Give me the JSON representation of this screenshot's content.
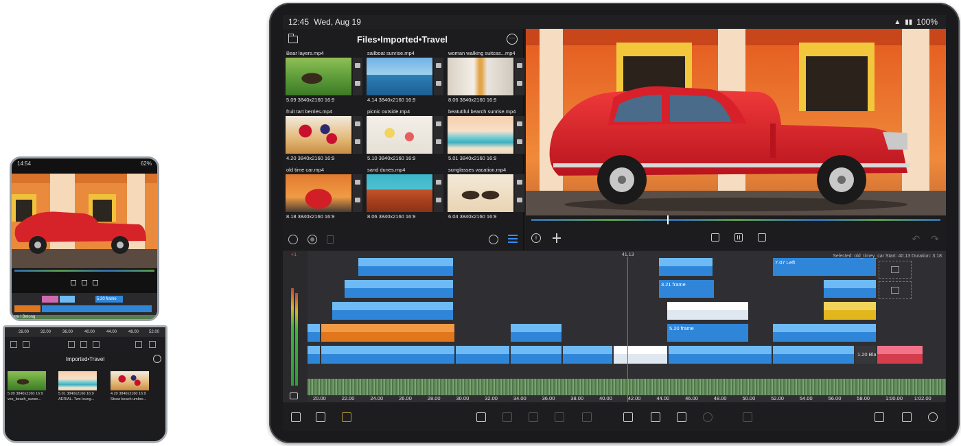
{
  "tablet": {
    "status": {
      "time": "12:45",
      "date": "Wed, Aug 19",
      "battery": "100%"
    },
    "browser": {
      "title": "Files•Imported•Travel",
      "clips": [
        {
          "name": "Bear layers.mp4",
          "meta": "5.09 3840x2160  16:9",
          "bg": "bg-bear"
        },
        {
          "name": "sailboat sunrise.mp4",
          "meta": "4.14 3840x2160  16:9",
          "bg": "bg-sail"
        },
        {
          "name": "woman walking suitcas...mp4",
          "meta": "8.06 3840x2160  16:9",
          "bg": "bg-walk"
        },
        {
          "name": "fruit tart berries.mp4",
          "meta": "4.20 3840x2160  16:9",
          "bg": "bg-berries"
        },
        {
          "name": "picnic outside.mp4",
          "meta": "5.10 3840x2160  16:9",
          "bg": "bg-picnic"
        },
        {
          "name": "beatutiful bearch sunrise.mp4",
          "meta": "5.01 3840x2160  16:9",
          "bg": "bg-beach"
        },
        {
          "name": "old time car.mp4",
          "meta": "8.18 3840x2160  16:9",
          "bg": "bg-car"
        },
        {
          "name": "sand dunes.mp4",
          "meta": "8.06 3840x2160  16:9",
          "bg": "bg-dunes"
        },
        {
          "name": "sunglasses vacation.mp4",
          "meta": "6.04 3840x2160  16:9",
          "bg": "bg-sun"
        }
      ]
    },
    "timeline": {
      "meter_top": "+1",
      "playhead_time": "41.13",
      "selection_info": "Selected: old_timey_car Start: 40.13 Duration: 3.18",
      "clips": [
        {
          "label": "6.18 Drone view of beautif",
          "cls": ""
        },
        {
          "label": "3.21 sunglass",
          "cls": ""
        },
        {
          "label": "7.07 Left",
          "cls": "plain"
        },
        {
          "label": "7.17 Cook pouring jelly on decor",
          "cls": ""
        },
        {
          "label": "3.21 frame",
          "cls": "plain"
        },
        {
          "label": "3.17 old",
          "cls": ""
        },
        {
          "label": "8.14 young woman in a long flowing d",
          "cls": ""
        },
        {
          "label": "5.20 Key lime pie",
          "cls": "white"
        },
        {
          "label": "3.17 old",
          "cls": "yellow"
        },
        {
          "label": "9.08 VENICE, ITALY - FEBRUARY 2015: Bur",
          "cls": "orange"
        },
        {
          "label": "3.16",
          "cls": ""
        },
        {
          "label": "5.20 frame",
          "cls": "plain"
        },
        {
          "label": "7.07 old_timey_car",
          "cls": ""
        },
        {
          "label": "9.08 Aerial view of foamy waves of Indian",
          "cls": ""
        },
        {
          "label": "3.21 w",
          "cls": ""
        },
        {
          "label": "3.16 4k",
          "cls": ""
        },
        {
          "label": "3.14 se",
          "cls": ""
        },
        {
          "label": "3.18 old",
          "cls": "white"
        },
        {
          "label": "3.14 beauti",
          "cls": ""
        },
        {
          "label": "3.18 AER",
          "cls": ""
        },
        {
          "label": "5.12 old_timey_car",
          "cls": ""
        },
        {
          "label": "1.20 Bla",
          "cls": "dark"
        },
        {
          "label": "3.20 fr",
          "cls": "red"
        },
        {
          "label": "beac",
          "cls": ""
        },
        {
          "label": "ers",
          "cls": ""
        }
      ],
      "ruler": [
        "20.00",
        "22.00",
        "24.00",
        "26.00",
        "28.00",
        "30.00",
        "32.00",
        "34.00",
        "36.00",
        "38.00",
        "40.00",
        "42.00",
        "44.00",
        "46.00",
        "48.00",
        "50.00",
        "52.00",
        "54.00",
        "56.00",
        "58.00",
        "1:00.00",
        "1:02.00"
      ]
    }
  },
  "phone": {
    "status": {
      "time": "14:54",
      "battery": "62%"
    },
    "browser_title": "Imported•Travel",
    "ruler": [
      "28.00",
      "32.00",
      "36.00",
      "40.00",
      "44.00",
      "48.00",
      "52.00"
    ],
    "clips": [
      {
        "meta": "5.09 3840x2160  16:9",
        "name": "ves_beach_sunse...",
        "bg": "bg-bear"
      },
      {
        "meta": "5.01 3840x2160  16:9",
        "name": "AERIAL. Two loung...",
        "bg": "bg-beach"
      },
      {
        "meta": "4.20 3840x2160  16:9",
        "name": "Straw beach umbre...",
        "bg": "bg-berries"
      }
    ],
    "track_label": "ere I Belong",
    "timeline_clip": "5.20 frame"
  },
  "colors": {
    "clip_blue": "#2f86d9",
    "clip_orange": "#e2761d",
    "clip_yellow": "#e2b61d",
    "clip_red": "#d33d4c",
    "playhead": "#3c7fd6"
  }
}
